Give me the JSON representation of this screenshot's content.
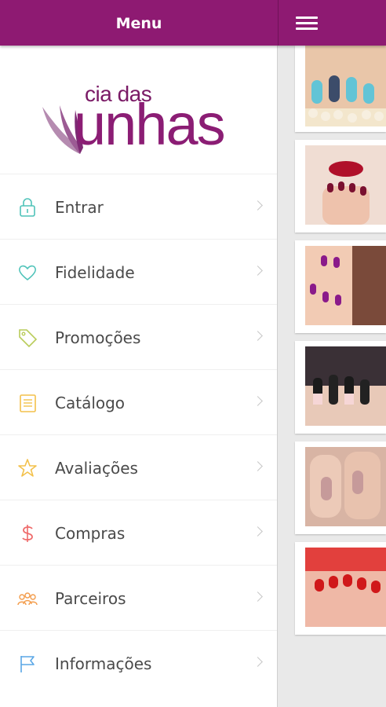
{
  "header": {
    "title": "Menu"
  },
  "brand": {
    "logo_small": "cia das",
    "logo_big": "unhas"
  },
  "menu": {
    "items": [
      {
        "label": "Entrar",
        "icon": "lock-icon",
        "color": "#4fc3b9"
      },
      {
        "label": "Fidelidade",
        "icon": "heart-icon",
        "color": "#4fc3b9"
      },
      {
        "label": "Promoções",
        "icon": "tag-icon",
        "color": "#b9cc5a"
      },
      {
        "label": "Catálogo",
        "icon": "catalog-icon",
        "color": "#f3c14b"
      },
      {
        "label": "Avaliações",
        "icon": "star-icon",
        "color": "#f3c14b"
      },
      {
        "label": "Compras",
        "icon": "dollar-icon",
        "color": "#ef6b6b"
      },
      {
        "label": "Parceiros",
        "icon": "partners-icon",
        "color": "#f39c4b"
      },
      {
        "label": "Informações",
        "icon": "flag-icon",
        "color": "#5aa7e6"
      }
    ]
  },
  "colors": {
    "primary": "#8e1a72"
  }
}
